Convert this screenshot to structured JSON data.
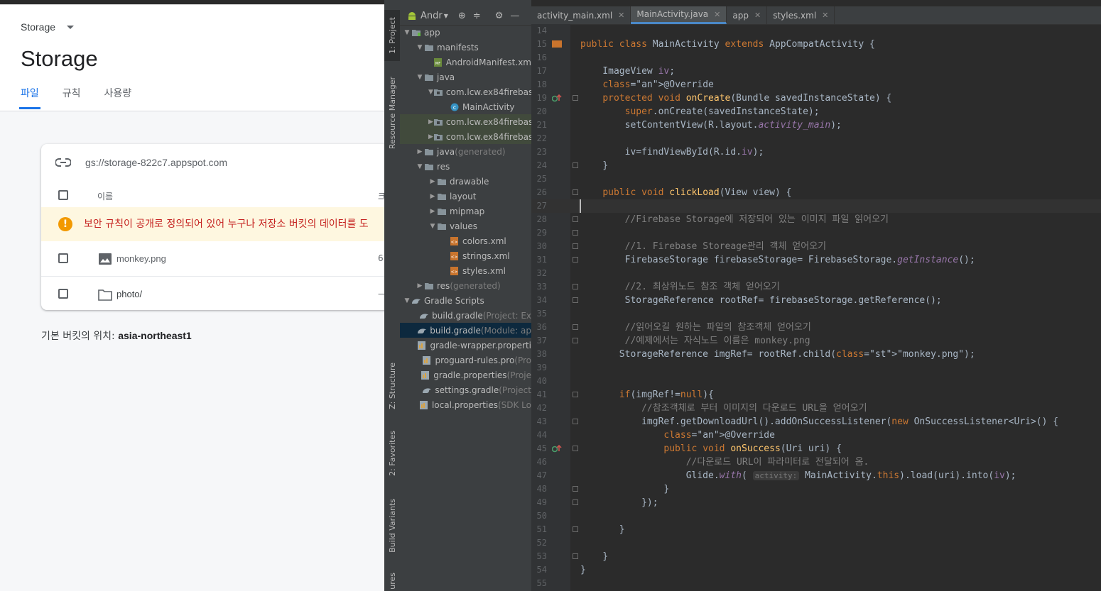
{
  "firebase": {
    "breadcrumb": "Storage",
    "title": "Storage",
    "tabs": [
      "파일",
      "규칙",
      "사용량"
    ],
    "bucket_url": "gs://storage-822c7.appspot.com",
    "table": {
      "col_name": "이름",
      "col_truncated": "크",
      "warning": "보안 규칙이 공개로 정의되어 있어 누구나 저장소 버킷의 데이터를 도",
      "files": [
        {
          "name": "monkey.png",
          "icon": "image-icon",
          "cut": "6"
        },
        {
          "name": "photo/",
          "icon": "folder-icon",
          "cut": "—"
        }
      ]
    },
    "location_label": "기본 버킷의 위치:",
    "location_value": "asia-northeast1"
  },
  "studio": {
    "side_tabs": [
      "1: Project",
      "Resource Manager",
      "Z: Structure",
      "2: Favorites",
      "Build Variants",
      "ures"
    ],
    "project_view": "Andr",
    "tree": [
      {
        "label": "app",
        "muted": "",
        "depth": 0,
        "arrow": "▼",
        "icon": "module-icon"
      },
      {
        "label": "manifests",
        "muted": "",
        "depth": 1,
        "arrow": "▼",
        "icon": "folder-icon"
      },
      {
        "label": "AndroidManifest.xm",
        "muted": "",
        "depth": 2,
        "arrow": "",
        "icon": "manifest-icon"
      },
      {
        "label": "java",
        "muted": "",
        "depth": 1,
        "arrow": "▼",
        "icon": "folder-icon"
      },
      {
        "label": "com.lcw.ex84firebas",
        "muted": "",
        "depth": 2,
        "arrow": "▼",
        "icon": "package-icon"
      },
      {
        "label": "MainActivity",
        "muted": "",
        "depth": 3,
        "arrow": "",
        "icon": "class-icon"
      },
      {
        "label": "com.lcw.ex84firebas",
        "muted": "",
        "depth": 2,
        "arrow": "▶",
        "icon": "package-icon"
      },
      {
        "label": "com.lcw.ex84firebas",
        "muted": "",
        "depth": 2,
        "arrow": "▶",
        "icon": "package-icon"
      },
      {
        "label": "java",
        "muted": " (generated)",
        "depth": 1,
        "arrow": "▶",
        "icon": "folder-icon"
      },
      {
        "label": "res",
        "muted": "",
        "depth": 1,
        "arrow": "▼",
        "icon": "folder-icon"
      },
      {
        "label": "drawable",
        "muted": "",
        "depth": 2,
        "arrow": "▶",
        "icon": "folder-icon"
      },
      {
        "label": "layout",
        "muted": "",
        "depth": 2,
        "arrow": "▶",
        "icon": "folder-icon"
      },
      {
        "label": "mipmap",
        "muted": "",
        "depth": 2,
        "arrow": "▶",
        "icon": "folder-icon"
      },
      {
        "label": "values",
        "muted": "",
        "depth": 2,
        "arrow": "▼",
        "icon": "folder-icon"
      },
      {
        "label": "colors.xml",
        "muted": "",
        "depth": 3,
        "arrow": "",
        "icon": "xml-icon"
      },
      {
        "label": "strings.xml",
        "muted": "",
        "depth": 3,
        "arrow": "",
        "icon": "xml-icon"
      },
      {
        "label": "styles.xml",
        "muted": "",
        "depth": 3,
        "arrow": "",
        "icon": "xml-icon"
      },
      {
        "label": "res",
        "muted": " (generated)",
        "depth": 1,
        "arrow": "▶",
        "icon": "folder-icon"
      },
      {
        "label": "Gradle Scripts",
        "muted": "",
        "depth": 0,
        "arrow": "▼",
        "icon": "gradle-icon"
      },
      {
        "label": "build.gradle",
        "muted": " (Project: Ex",
        "depth": 1,
        "arrow": "",
        "icon": "gradle-icon"
      },
      {
        "label": "build.gradle",
        "muted": " (Module: ap",
        "depth": 1,
        "arrow": "",
        "icon": "gradle-icon"
      },
      {
        "label": "gradle-wrapper.properti",
        "muted": "",
        "depth": 1,
        "arrow": "",
        "icon": "properties-icon"
      },
      {
        "label": "proguard-rules.pro",
        "muted": " (Pro",
        "depth": 1,
        "arrow": "",
        "icon": "properties-icon"
      },
      {
        "label": "gradle.properties",
        "muted": " (Proje",
        "depth": 1,
        "arrow": "",
        "icon": "properties-icon"
      },
      {
        "label": "settings.gradle",
        "muted": " (Project",
        "depth": 1,
        "arrow": "",
        "icon": "gradle-icon"
      },
      {
        "label": "local.properties",
        "muted": " (SDK Lo",
        "depth": 1,
        "arrow": "",
        "icon": "properties-icon"
      }
    ],
    "editor_tabs": [
      {
        "label": "activity_main.xml",
        "icon": "xml-icon"
      },
      {
        "label": "MainActivity.java",
        "icon": "class-icon"
      },
      {
        "label": "app",
        "icon": "gradle-icon"
      },
      {
        "label": "styles.xml",
        "icon": "xml-icon"
      }
    ],
    "code_lines": [
      {
        "n": "14",
        "t": ""
      },
      {
        "n": "15",
        "t": "public class MainActivity extends AppCompatActivity {"
      },
      {
        "n": "16",
        "t": ""
      },
      {
        "n": "17",
        "t": "    ImageView iv;"
      },
      {
        "n": "18",
        "t": "    @Override"
      },
      {
        "n": "19",
        "t": "    protected void onCreate(Bundle savedInstanceState) {"
      },
      {
        "n": "20",
        "t": "        super.onCreate(savedInstanceState);"
      },
      {
        "n": "21",
        "t": "        setContentView(R.layout.activity_main);"
      },
      {
        "n": "22",
        "t": ""
      },
      {
        "n": "23",
        "t": "        iv=findViewById(R.id.iv);"
      },
      {
        "n": "24",
        "t": "    }"
      },
      {
        "n": "25",
        "t": ""
      },
      {
        "n": "26",
        "t": "    public void clickLoad(View view) {"
      },
      {
        "n": "27",
        "t": ""
      },
      {
        "n": "28",
        "t": "        //Firebase Storage에 저장되어 있는 이미지 파일 읽어오기"
      },
      {
        "n": "29",
        "t": ""
      },
      {
        "n": "30",
        "t": "        //1. Firebase Storeage관리 객체 얻어오기"
      },
      {
        "n": "31",
        "t": "        FirebaseStorage firebaseStorage= FirebaseStorage.getInstance();"
      },
      {
        "n": "32",
        "t": ""
      },
      {
        "n": "33",
        "t": "        //2. 최상위노드 참조 객체 얻어오기"
      },
      {
        "n": "34",
        "t": "        StorageReference rootRef= firebaseStorage.getReference();"
      },
      {
        "n": "35",
        "t": ""
      },
      {
        "n": "36",
        "t": "        //읽어오길 원하는 파일의 참조객체 얻어오기"
      },
      {
        "n": "37",
        "t": "        //예제에서는 자식노드 이름은 monkey.png"
      },
      {
        "n": "38",
        "t": "       StorageReference imgRef= rootRef.child(\"monkey.png\");"
      },
      {
        "n": "39",
        "t": ""
      },
      {
        "n": "40",
        "t": ""
      },
      {
        "n": "41",
        "t": "       if(imgRef!=null){"
      },
      {
        "n": "42",
        "t": "           //참조객체로 부터 이미지의 다운로드 URL을 얻어오기"
      },
      {
        "n": "43",
        "t": "           imgRef.getDownloadUrl().addOnSuccessListener(new OnSuccessListener<Uri>() {"
      },
      {
        "n": "44",
        "t": "               @Override"
      },
      {
        "n": "45",
        "t": "               public void onSuccess(Uri uri) {"
      },
      {
        "n": "46",
        "t": "                   //다운로드 URL이 파라미터로 전달되어 옴."
      },
      {
        "n": "47",
        "t": "                   Glide.with( activity: MainActivity.this).load(uri).into(iv);"
      },
      {
        "n": "48",
        "t": "               }"
      },
      {
        "n": "49",
        "t": "           });"
      },
      {
        "n": "50",
        "t": ""
      },
      {
        "n": "51",
        "t": "       }"
      },
      {
        "n": "52",
        "t": ""
      },
      {
        "n": "53",
        "t": "    }"
      },
      {
        "n": "54",
        "t": "}"
      },
      {
        "n": "55",
        "t": ""
      }
    ],
    "colors": {
      "keyword": "#cc7832",
      "comment": "#808080",
      "string": "#6a8759",
      "annotation": "#bbb529",
      "method": "#ffc66d",
      "field": "#9876aa"
    }
  }
}
